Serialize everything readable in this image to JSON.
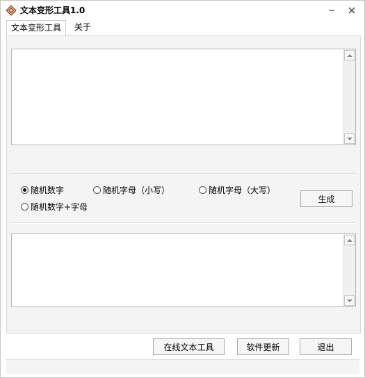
{
  "window": {
    "title": "文本变形工具1.0",
    "app_icon": "diamond-app-icon"
  },
  "titlebar": {
    "minimize_icon": "minimize-icon",
    "close_icon": "close-icon"
  },
  "menu": {
    "items": [
      {
        "label": "文本变形工具"
      },
      {
        "label": "关于"
      }
    ]
  },
  "options": {
    "items": [
      {
        "label": "随机数字",
        "selected": true
      },
      {
        "label": "随机字母（小写）",
        "selected": false
      },
      {
        "label": "随机字母（大写）",
        "selected": false
      },
      {
        "label": "随机数字+字母",
        "selected": false
      }
    ],
    "generate_label": "生成"
  },
  "footer": {
    "online_tools_label": "在线文本工具",
    "update_label": "软件更新",
    "exit_label": "退出"
  },
  "colors": {
    "icon_accent": "#c0392b",
    "icon_body": "#d9b38c"
  }
}
